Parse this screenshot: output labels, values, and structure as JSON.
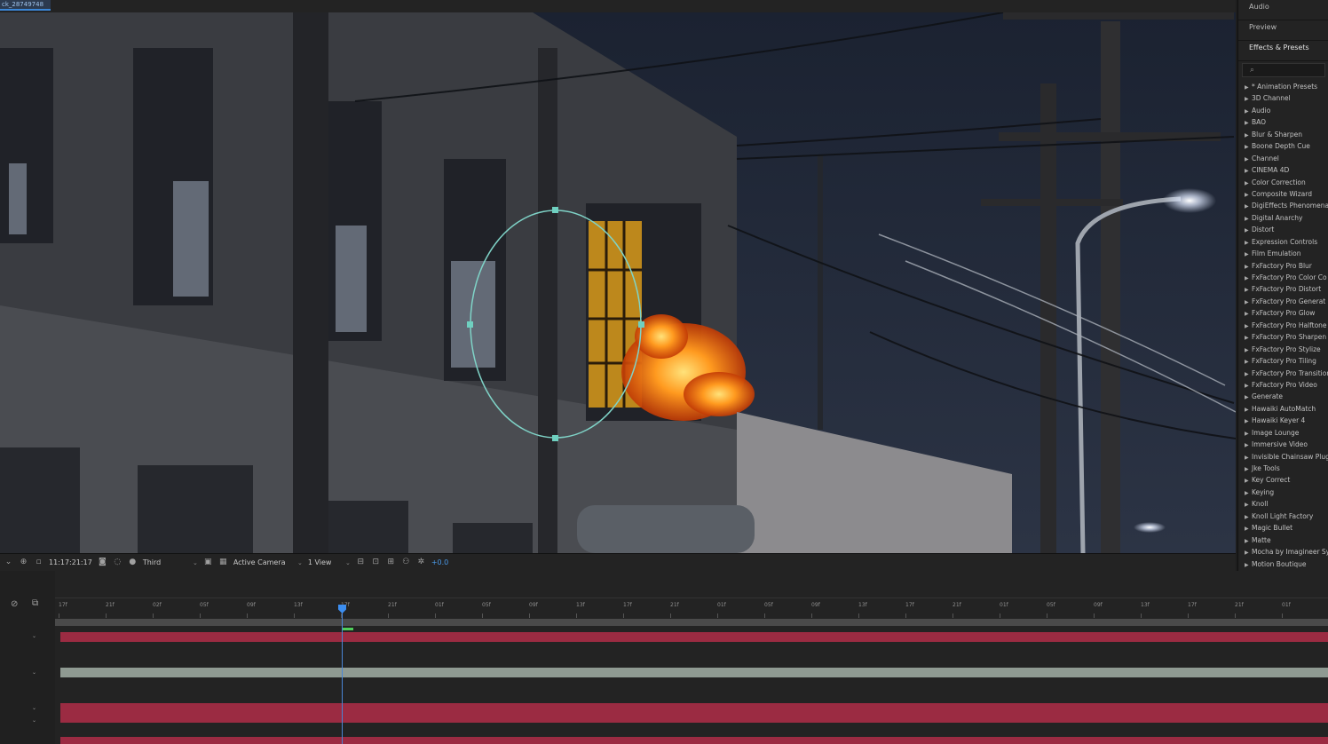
{
  "composition": {
    "tab_label": "ck_28749748"
  },
  "viewer_bar": {
    "timecode": "11:17:21:17",
    "quality": "Third",
    "camera": "Active Camera",
    "views": "1 View",
    "exposure": "+0.0"
  },
  "panel": {
    "tabs": [
      "Audio",
      "Preview",
      "Effects & Presets"
    ],
    "active_tab": "Effects & Presets",
    "search_placeholder": "",
    "categories": [
      "* Animation Presets",
      "3D Channel",
      "Audio",
      "BAO",
      "Blur & Sharpen",
      "Boone Depth Cue",
      "Channel",
      "CINEMA 4D",
      "Color Correction",
      "Composite Wizard",
      "DigiEffects Phenomena",
      "Digital Anarchy",
      "Distort",
      "Expression Controls",
      "Film Emulation",
      "FxFactory Pro Blur",
      "FxFactory Pro Color Co",
      "FxFactory Pro Distort",
      "FxFactory Pro Generat",
      "FxFactory Pro Glow",
      "FxFactory Pro Halftone",
      "FxFactory Pro Sharpen",
      "FxFactory Pro Stylize",
      "FxFactory Pro Tiling",
      "FxFactory Pro Transition",
      "FxFactory Pro Video",
      "Generate",
      "Hawaiki AutoMatch",
      "Hawaiki Keyer 4",
      "Image Lounge",
      "Immersive Video",
      "Invisible Chainsaw Plug",
      "Jke Tools",
      "Key Correct",
      "Keying",
      "Knoll",
      "Knoll Light Factory",
      "Magic Bullet",
      "Matte",
      "Mocha by Imagineer Sy",
      "Motion Boutique"
    ]
  },
  "timeline": {
    "ruler_labels": [
      "17f",
      "21f",
      "02f",
      "05f",
      "09f",
      "13f",
      "17f",
      "21f",
      "01f",
      "05f",
      "09f",
      "13f",
      "17f",
      "21f",
      "01f",
      "05f",
      "09f",
      "13f",
      "17f",
      "21f",
      "01f",
      "05f",
      "09f",
      "13f",
      "17f",
      "21f",
      "01f",
      "05f"
    ],
    "colors": {
      "red_track": "#9b2b42",
      "grey_track": "#8f9a92",
      "playhead": "#3c8ef0"
    }
  }
}
